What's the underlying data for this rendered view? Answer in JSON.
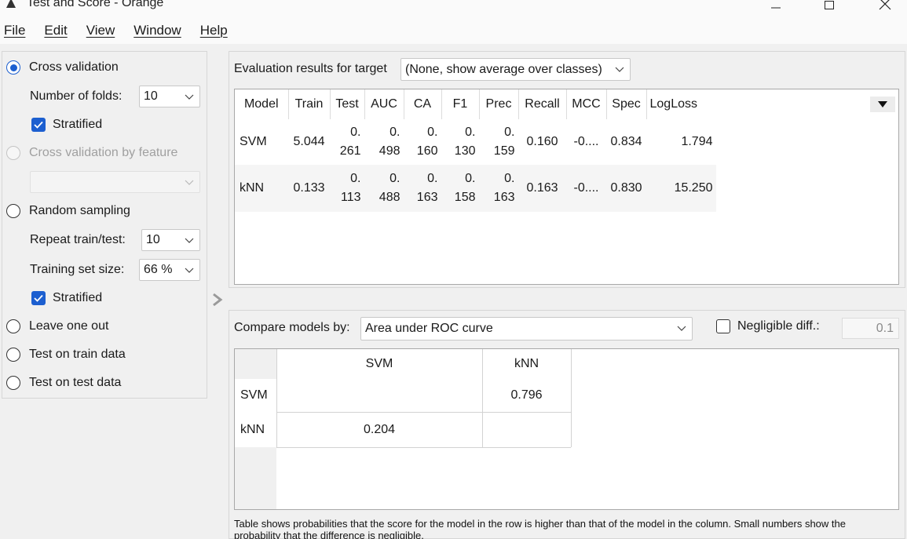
{
  "window": {
    "title": "Test and Score - Orange"
  },
  "menu": [
    "File",
    "Edit",
    "View",
    "Window",
    "Help"
  ],
  "sampling": {
    "cross_validation": "Cross validation",
    "folds_label": "Number of folds:",
    "folds_value": "10",
    "stratified_label": "Stratified",
    "cv_by_feature": "Cross validation by feature",
    "random_sampling": "Random sampling",
    "repeat_label": "Repeat train/test:",
    "repeat_value": "10",
    "train_size_label": "Training set size:",
    "train_size_value": "66 %",
    "stratified2_label": "Stratified",
    "leave_one_out": "Leave one out",
    "test_on_train": "Test on train data",
    "test_on_test": "Test on test data",
    "selected": "Cross validation"
  },
  "evaluation": {
    "target_label": "Evaluation results for target",
    "target_value": "(None, show average over classes)",
    "columns": [
      "Model",
      "Train",
      "Test",
      "AUC",
      "CA",
      "F1",
      "Prec",
      "Recall",
      "MCC",
      "Spec",
      "LogLoss"
    ],
    "rows": [
      {
        "model": "SVM",
        "train": "5.044",
        "test": [
          "0.",
          "261"
        ],
        "auc": [
          "0.",
          "498"
        ],
        "ca": [
          "0.",
          "160"
        ],
        "f1": [
          "0.",
          "130"
        ],
        "prec": [
          "0.",
          "159"
        ],
        "recall": "0.160",
        "mcc": "-0....",
        "spec": "0.834",
        "logloss": "1.794"
      },
      {
        "model": "kNN",
        "train": "0.133",
        "test": [
          "0.",
          "113"
        ],
        "auc": [
          "0.",
          "488"
        ],
        "ca": [
          "0.",
          "163"
        ],
        "f1": [
          "0.",
          "158"
        ],
        "prec": [
          "0.",
          "163"
        ],
        "recall": "0.163",
        "mcc": "-0....",
        "spec": "0.830",
        "logloss": "15.250"
      }
    ]
  },
  "compare": {
    "label": "Compare models by:",
    "metric": "Area under ROC curve",
    "negligible_label": "Negligible diff.:",
    "negligible_value": "0.1",
    "models": [
      "SVM",
      "kNN"
    ],
    "svm_vs_knn": "0.796",
    "knn_vs_svm": "0.204",
    "footnote": "Table shows probabilities that the score for the model in the row is higher than that of the model in the column. Small numbers show the probability that the difference is negligible."
  }
}
